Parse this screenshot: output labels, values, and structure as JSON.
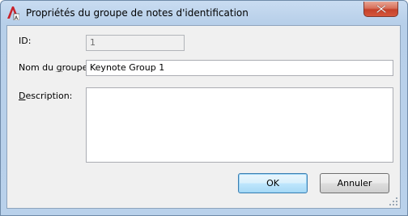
{
  "window": {
    "title": "Propriétés du groupe de notes d'identification",
    "close_icon": "close-icon",
    "app_icon": "autocad-app-icon"
  },
  "form": {
    "id_label": "ID:",
    "id_value": "1",
    "name_label_prefix": "Nom du ",
    "name_label_accel": "g",
    "name_label_suffix": "roupe:",
    "name_value": "Keynote Group 1",
    "description_label_accel": "D",
    "description_label_suffix": "escription:",
    "description_value": ""
  },
  "buttons": {
    "ok_label": "OK",
    "cancel_label": "Annuler"
  },
  "colors": {
    "title_bar": "#b9d1eb",
    "close_button": "#c4412a",
    "default_button_border": "#3c7fb1",
    "client_background": "#f0f0f0"
  }
}
